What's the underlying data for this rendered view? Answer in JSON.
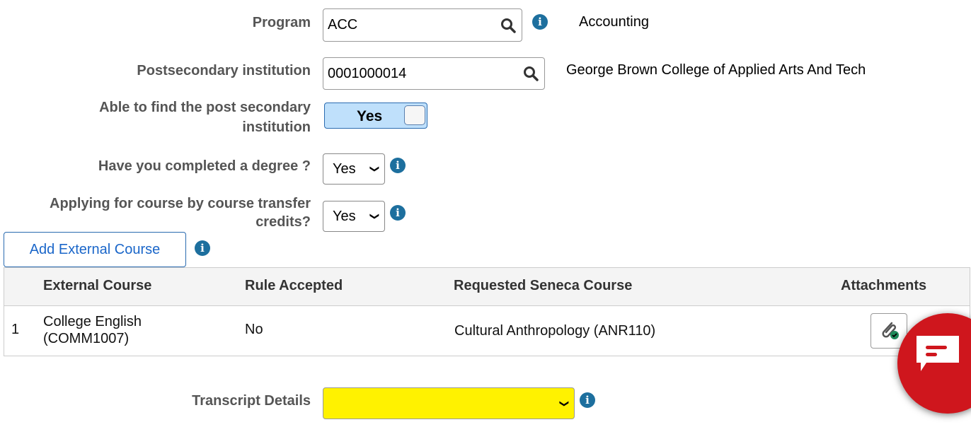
{
  "program": {
    "label": "Program",
    "value": "ACC",
    "description": "Accounting"
  },
  "institution": {
    "label": "Postsecondary institution",
    "value": "0001000014",
    "description": "George Brown College of Applied Arts And Tech"
  },
  "able_to_find": {
    "label_line1": "Able to find the post secondary",
    "label_line2": "institution",
    "toggle": "Yes"
  },
  "degree": {
    "label": "Have you completed a degree ?",
    "value": "Yes"
  },
  "transfer": {
    "label_line1": "Applying for course by course transfer",
    "label_line2": "credits?",
    "value": "Yes"
  },
  "add_course_button": "Add External Course",
  "table": {
    "headers": [
      "External Course",
      "Rule Accepted",
      "Requested Seneca Course",
      "Attachments"
    ],
    "rows": [
      {
        "num": "1",
        "external_line1": "College English",
        "external_line2": "(COMM1007)",
        "rule": "No",
        "requested": "Cultural Anthropology (ANR110)"
      }
    ]
  },
  "transcript": {
    "label": "Transcript Details",
    "value": ""
  },
  "colors": {
    "info": "#1d6f9e",
    "toggle_bg": "#bfe0fb",
    "transcript_bg": "#fff200",
    "chat": "#cf161d",
    "link": "#1a66c9"
  },
  "icons": [
    "search-icon",
    "info-icon",
    "paperclip-icon",
    "chat-icon",
    "chevron-down-icon"
  ]
}
